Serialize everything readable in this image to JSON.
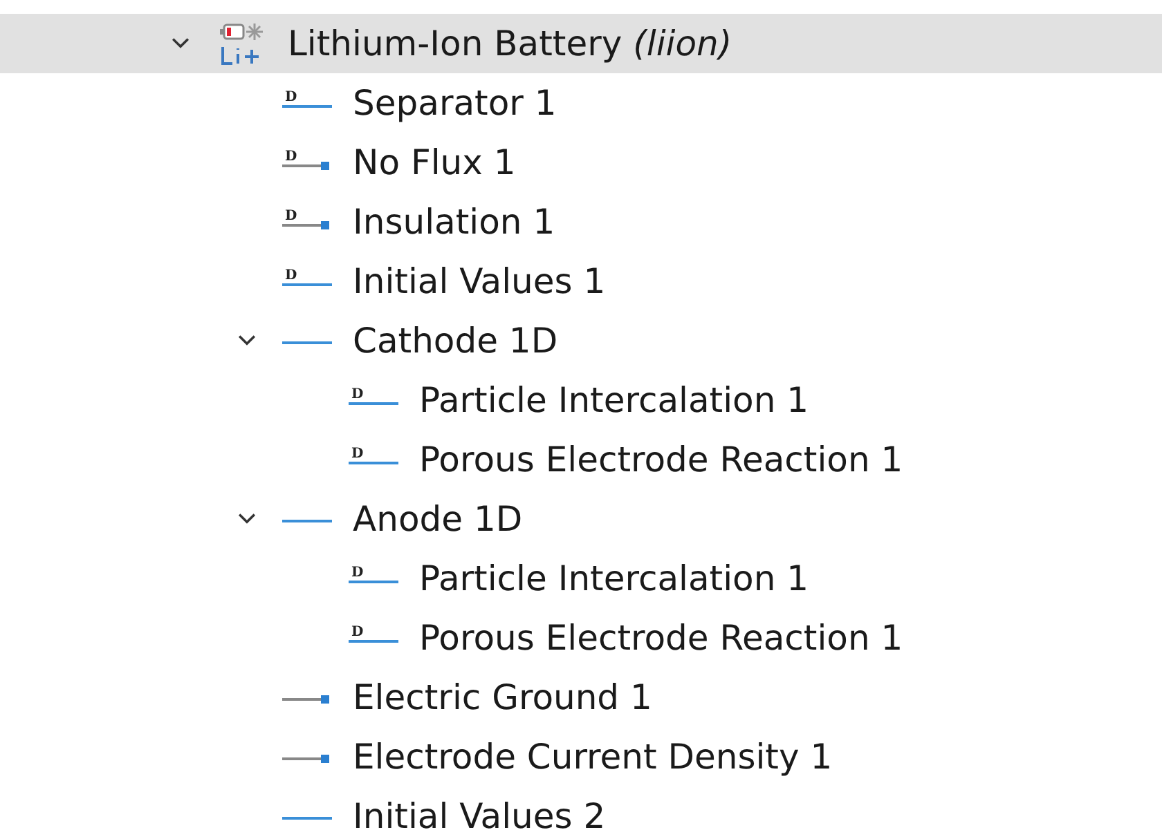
{
  "tree": [
    {
      "label": "Lithium-Ion Battery *(liion)*",
      "kind": "battery",
      "selected": true,
      "expanded": true,
      "children": [
        {
          "label": "Separator 1",
          "kind": "domain",
          "icon_letter": "D",
          "selected": false
        },
        {
          "label": "No Flux 1",
          "kind": "boundary",
          "icon_letter": "D",
          "selected": false
        },
        {
          "label": "Insulation 1",
          "kind": "boundary",
          "icon_letter": "D",
          "selected": false
        },
        {
          "label": "Initial Values 1",
          "kind": "domain",
          "icon_letter": "D",
          "selected": false
        },
        {
          "label": "Cathode 1D",
          "kind": "domain",
          "selected": false,
          "expanded": true,
          "children": [
            {
              "label": "Particle Intercalation 1",
              "kind": "domain",
              "icon_letter": "D",
              "selected": false
            },
            {
              "label": "Porous Electrode Reaction 1",
              "kind": "domain",
              "icon_letter": "D",
              "selected": false
            }
          ]
        },
        {
          "label": "Anode 1D",
          "kind": "domain",
          "selected": false,
          "expanded": true,
          "children": [
            {
              "label": "Particle Intercalation 1",
              "kind": "domain",
              "icon_letter": "D",
              "selected": false
            },
            {
              "label": "Porous Electrode Reaction 1",
              "kind": "domain",
              "icon_letter": "D",
              "selected": false
            }
          ]
        },
        {
          "label": "Electric Ground 1",
          "kind": "boundary",
          "selected": false
        },
        {
          "label": "Electrode Current Density 1",
          "kind": "boundary",
          "selected": false
        },
        {
          "label": "Initial Values 2",
          "kind": "domain",
          "selected": false
        }
      ]
    }
  ]
}
